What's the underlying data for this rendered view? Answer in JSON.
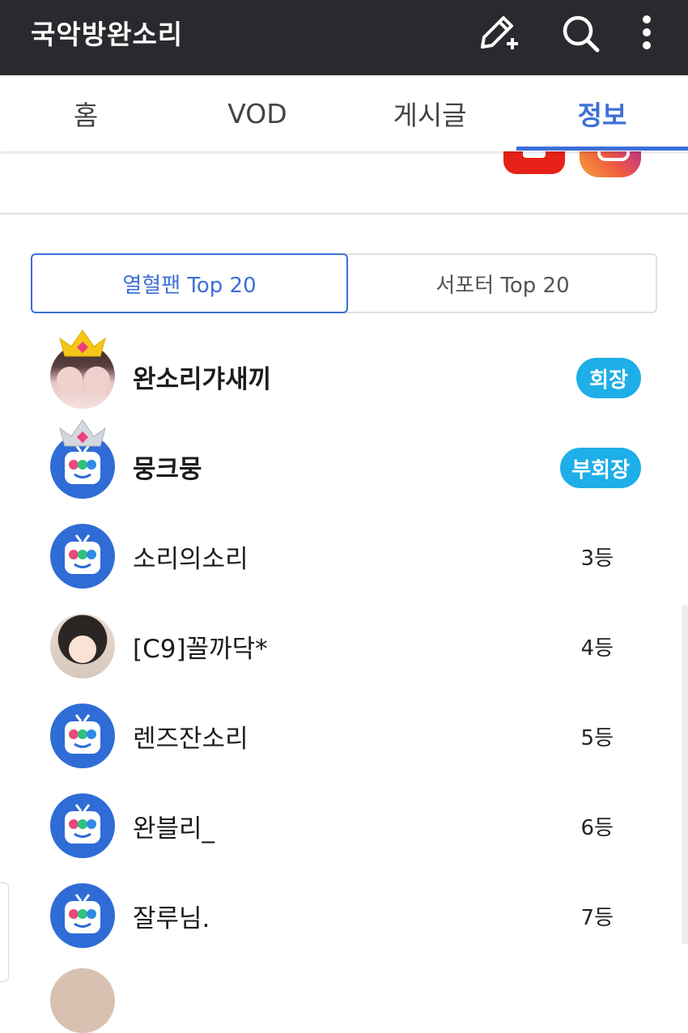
{
  "app": {
    "title": "국악방완소리",
    "actions": [
      {
        "icon": "edit-icon"
      },
      {
        "icon": "search-icon"
      },
      {
        "icon": "more-vertical-icon"
      }
    ],
    "bar_color": "#2a2a2e"
  },
  "tabs": [
    {
      "label": "홈",
      "active": false
    },
    {
      "label": "VOD",
      "active": false
    },
    {
      "label": "게시글",
      "active": false
    },
    {
      "label": "정보",
      "active": true
    }
  ],
  "accent_color": "#3d6fd8",
  "social_icons": [
    "youtube-icon",
    "instagram-icon"
  ],
  "ranking": {
    "segments": [
      {
        "label": "열혈팬 Top 20",
        "selected": true
      },
      {
        "label": "서포터 Top 20",
        "selected": false
      }
    ],
    "entries": [
      {
        "name": "완소리갸새끼",
        "badge": "회장",
        "avatar": "photo",
        "crown": "gold"
      },
      {
        "name": "뭉크뭉",
        "badge": "부회장",
        "avatar": "default",
        "crown": "silver"
      },
      {
        "name": "소리의소리",
        "rank": "3등",
        "avatar": "default"
      },
      {
        "name": "[C9]꼴까닥*",
        "rank": "4등",
        "avatar": "photo"
      },
      {
        "name": "렌즈잔소리",
        "rank": "5등",
        "avatar": "default"
      },
      {
        "name": "완블리_",
        "rank": "6등",
        "avatar": "default"
      },
      {
        "name": "잘루님.",
        "rank": "7등",
        "avatar": "default"
      }
    ],
    "badge_color": "#1eaee8"
  }
}
